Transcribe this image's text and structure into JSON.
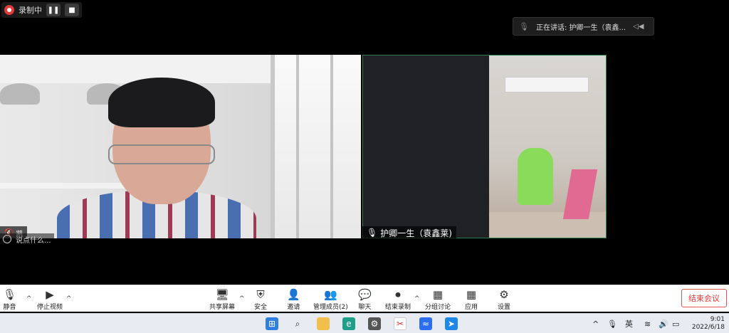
{
  "recording": {
    "label": "录制中",
    "pause_icon": "pause-icon",
    "stop_icon": "stop-icon"
  },
  "speaking": {
    "text": "正在讲话: 护卿一生（袁鑫...",
    "mic_icon": "mic-icon"
  },
  "participants": [
    {
      "name": "凯",
      "mic": "muted"
    },
    {
      "name": "护卿一生（袁鑫莱)",
      "mic": "on"
    }
  ],
  "chat": {
    "placeholder": "说点什么..."
  },
  "toolbar": {
    "mute": "静音",
    "stop_video": "停止视频",
    "share_screen": "共享屏幕",
    "security": "安全",
    "invite": "邀请",
    "manage_members": "管理成员(2)",
    "chat": "聊天",
    "end_recording": "结束录制",
    "breakout": "分组讨论",
    "apps": "应用",
    "settings": "设置",
    "end_meeting": "结束会议"
  },
  "taskbar": {
    "ime": "英",
    "time": "9:01",
    "date": "2022/6/18"
  },
  "colors": {
    "end_red": "#e03a3a",
    "tile_border": "#2a7a4a"
  }
}
